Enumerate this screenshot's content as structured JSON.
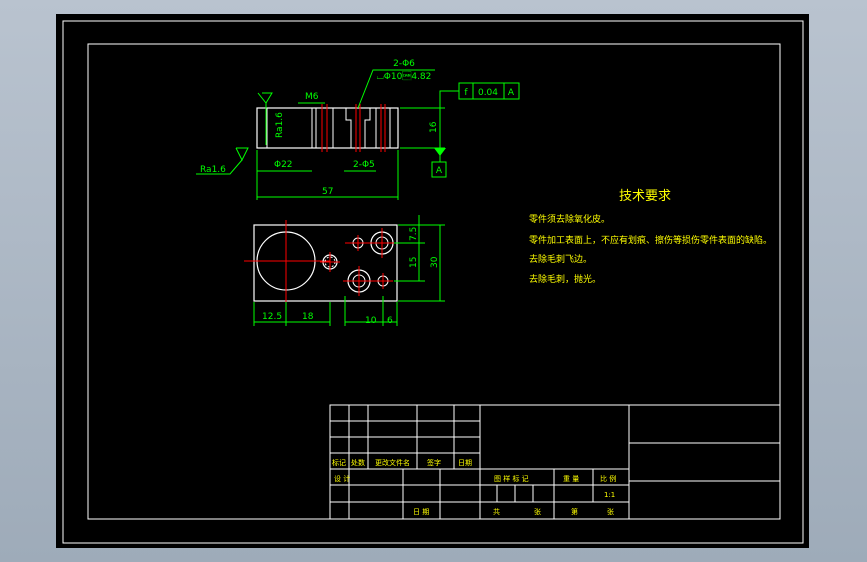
{
  "colors": {
    "background_outer": "#b0bac6",
    "paper": "#000000",
    "frame": "#ffffff",
    "dimension": "#00ff00",
    "centerline": "#ff0000",
    "leader": "#00ff00",
    "annotation_text": "#00ff00",
    "tech_text": "#ffff00",
    "section_line": "#ff0000"
  },
  "front_view": {
    "callout_holes_count": "2-Φ6",
    "callout_counterbore": "⌴Φ10\u00184.82",
    "thread_label": "M6",
    "roughness_left": "Ra1.6",
    "roughness_bottom": "Ra1.6",
    "dim_bore": "Φ22",
    "dim_holes": "2-Φ5",
    "dim_length": "57",
    "dim_height": "16",
    "tolerance_symbol": "f",
    "tolerance_value": "0.04",
    "tolerance_datum": "A",
    "datum_label": "A"
  },
  "top_view": {
    "dim_a": "12.5",
    "dim_b": "18",
    "dim_c": "10",
    "dim_d": "6",
    "dim_r1": "7.5",
    "dim_r2": "15",
    "dim_total_h": "30"
  },
  "tech_requirements": {
    "title": "技术要求",
    "items": [
      "零件须去除氧化皮。",
      "零件加工表面上，不应有划痕、擦伤等损伤零件表面的缺陷。",
      "去除毛刺飞边。",
      "去除毛刺，抛光。"
    ]
  },
  "title_block": {
    "row_labels": [
      "标记",
      "处数",
      "更改文件名",
      "签字",
      "日期"
    ],
    "design_label": "设 计",
    "date_label": "日 期",
    "stage_labels": [
      "图 样 标 记",
      "重 量",
      "比 例"
    ],
    "scale_value": "1:1",
    "sheet_labels": [
      "共",
      "张",
      "第",
      "张"
    ]
  }
}
